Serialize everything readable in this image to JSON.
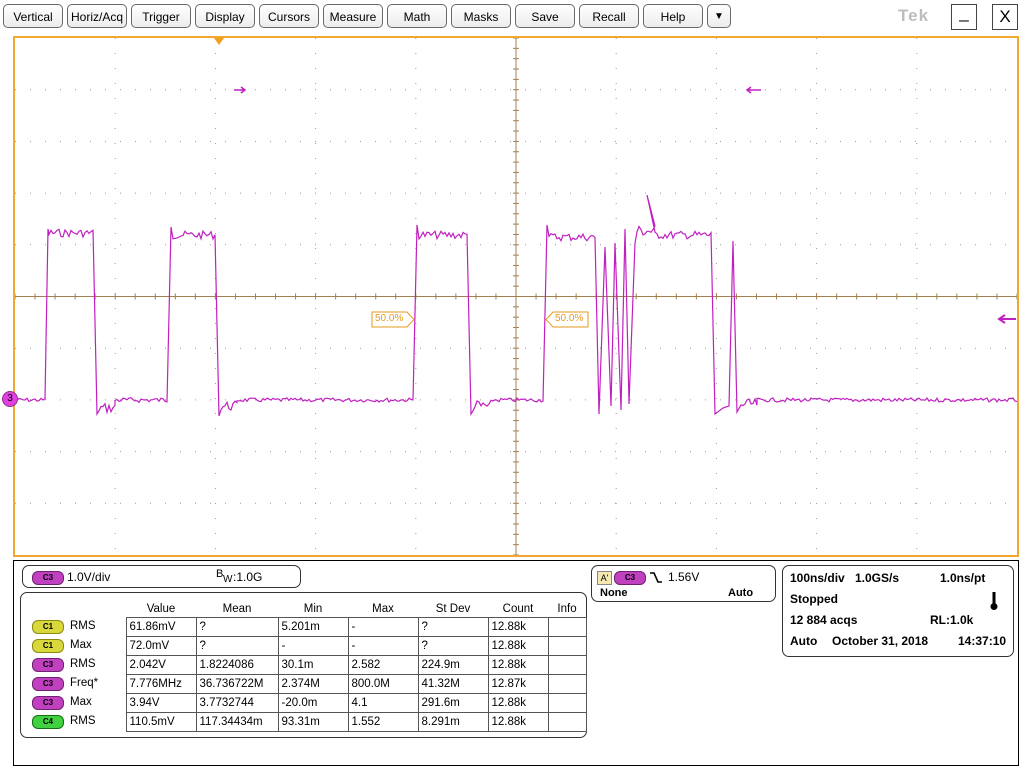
{
  "menu": {
    "items": [
      "Vertical",
      "Horiz/Acq",
      "Trigger",
      "Display",
      "Cursors",
      "Measure",
      "Math",
      "Masks",
      "Save",
      "Recall",
      "Help"
    ],
    "dropdown_glyph": "▼",
    "brand": "Tek",
    "minimize": "_",
    "close": "X"
  },
  "screen": {
    "ref_left": "50.0%",
    "ref_right": "50.0%",
    "channel_marker": "3",
    "colors": {
      "trace": "#c020c0",
      "grid_center": "#a08050",
      "border": "#f0a830"
    }
  },
  "channel_panel": {
    "badge": "C3",
    "scale": "1.0V/div",
    "bw_prefix": "B",
    "bw_sub": "W",
    "bw_value": ":1.0G"
  },
  "trigger_panel": {
    "a_label": "A'",
    "badge": "C3",
    "slope_icon": "falling-edge",
    "level": "1.56V",
    "source": "None",
    "mode": "Auto"
  },
  "horiz_panel": {
    "timebase": "100ns/div",
    "sample_rate": "1.0GS/s",
    "resolution": "1.0ns/pt",
    "state": "Stopped",
    "acqs": "12 884 acqs",
    "record_length": "RL:1.0k",
    "trigger_mode": "Auto",
    "date": "October 31, 2018",
    "time": "14:37:10"
  },
  "measurements": {
    "headers": [
      "Value",
      "Mean",
      "Min",
      "Max",
      "St Dev",
      "Count",
      "Info"
    ],
    "rows": [
      {
        "ch": "C1",
        "ch_class": "c1",
        "type": "RMS",
        "value": "61.86mV",
        "mean": "?",
        "min": "5.201m",
        "max": "-",
        "stdev": "?",
        "count": "12.88k",
        "info": ""
      },
      {
        "ch": "C1",
        "ch_class": "c1",
        "type": "Max",
        "value": "72.0mV",
        "mean": "?",
        "min": "-",
        "max": "-",
        "stdev": "?",
        "count": "12.88k",
        "info": ""
      },
      {
        "ch": "C3",
        "ch_class": "c3",
        "type": "RMS",
        "value": "2.042V",
        "mean": "1.8224086",
        "min": "30.1m",
        "max": "2.582",
        "stdev": "224.9m",
        "count": "12.88k",
        "info": ""
      },
      {
        "ch": "C3",
        "ch_class": "c3",
        "type": "Freq*",
        "value": "7.776MHz",
        "mean": "36.736722M",
        "min": "2.374M",
        "max": "800.0M",
        "stdev": "41.32M",
        "count": "12.87k",
        "info": ""
      },
      {
        "ch": "C3",
        "ch_class": "c3",
        "type": "Max",
        "value": "3.94V",
        "mean": "3.7732744",
        "min": "-20.0m",
        "max": "4.1",
        "stdev": "291.6m",
        "count": "12.88k",
        "info": ""
      },
      {
        "ch": "C4",
        "ch_class": "c4",
        "type": "RMS",
        "value": "110.5mV",
        "mean": "117.34434m",
        "min": "93.31m",
        "max": "1.552",
        "stdev": "8.291m",
        "count": "12.88k",
        "info": ""
      }
    ]
  }
}
